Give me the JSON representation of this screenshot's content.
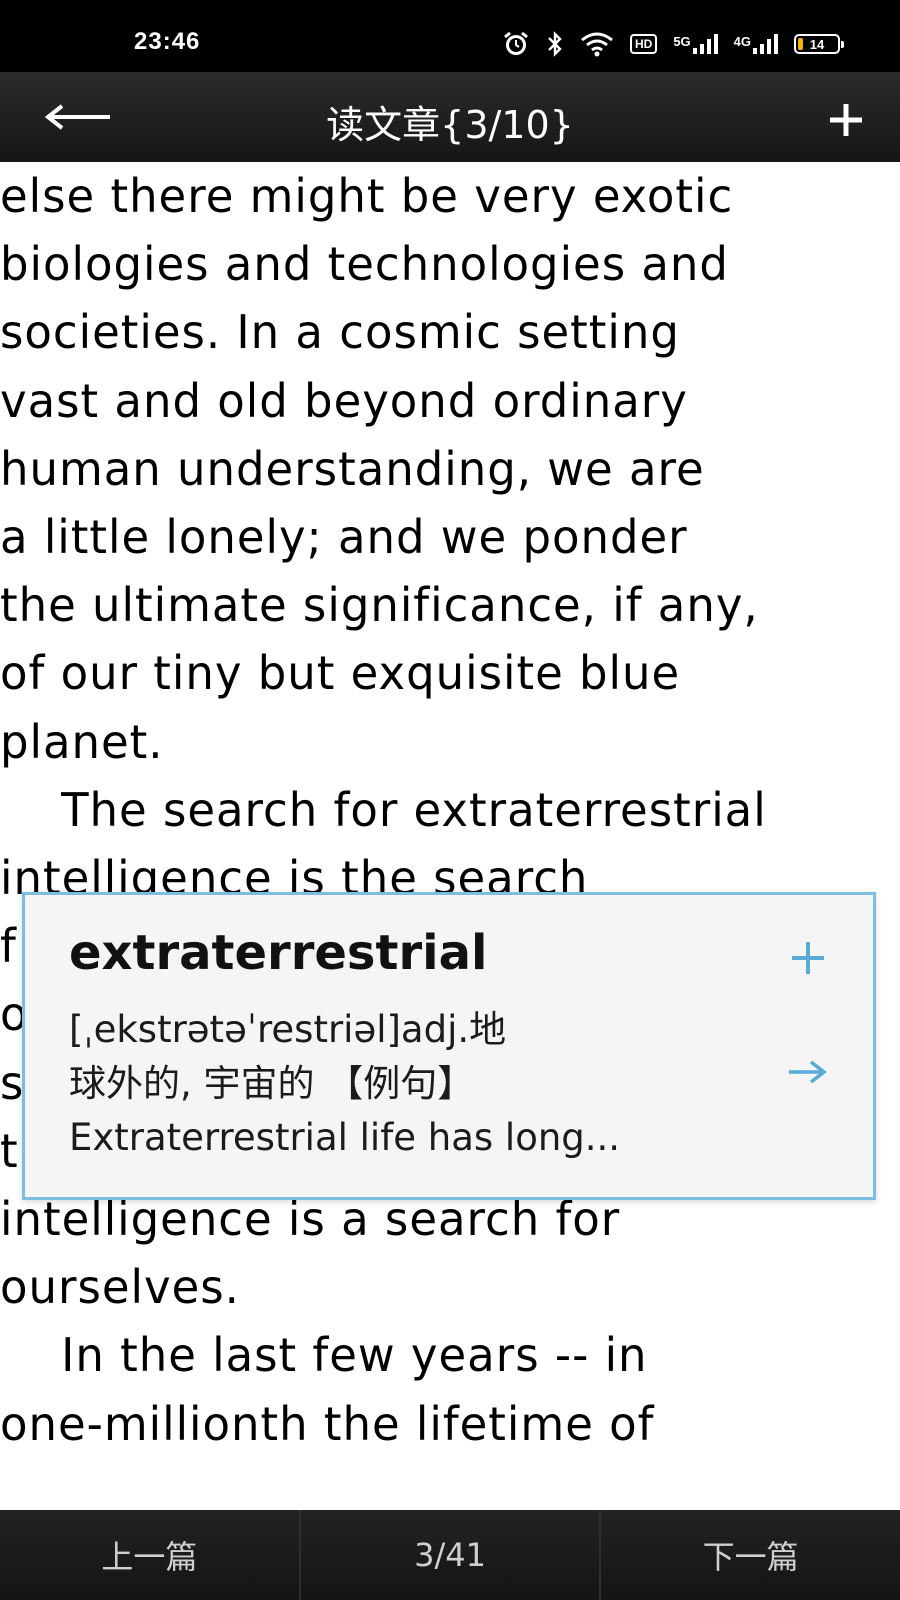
{
  "status_bar": {
    "time": "23:46",
    "hd_label": "HD",
    "net1_label": "5G",
    "net2_label": "4G",
    "battery_level": "14",
    "battery_fraction": 0.14,
    "icons": [
      "alarm-icon",
      "bluetooth-icon",
      "wifi-icon",
      "hd-icon",
      "signal-5g-icon",
      "signal-4g-icon",
      "battery-icon"
    ]
  },
  "header": {
    "title": "读文章{3/10}",
    "back_icon": "back-arrow-icon",
    "add_icon": "plus-icon"
  },
  "article": {
    "lines": [
      "else there might be very exotic",
      "biologies and technologies and",
      "societies. In a cosmic setting",
      "vast and old beyond ordinary",
      "human understanding, we are",
      "a little lonely; and we ponder",
      "the ultimate significance, if any,",
      "of our tiny but exquisite blue",
      "planet.",
      "    The search for extraterrestrial",
      "intelligence is the search",
      "f",
      "o",
      "s",
      "t",
      "intelligence is a search for",
      "ourselves.",
      "    In the last few years -- in",
      "one-millionth the lifetime of"
    ]
  },
  "popup": {
    "word": "extraterrestrial",
    "definition_lines": [
      "[ˌekstrətəˈrestriəl]adj.地",
      "球外的, 宇宙的 【例句】",
      "Extraterrestrial life has long..."
    ],
    "add_icon": "plus-icon",
    "more_icon": "arrow-right-icon"
  },
  "bottom_bar": {
    "prev_label": "上一篇",
    "page_indicator": "3/41",
    "next_label": "下一篇"
  },
  "colors": {
    "accent": "#5aaad8",
    "bar_bg": "#1a1a1a",
    "popup_border": "#7cbde0"
  }
}
